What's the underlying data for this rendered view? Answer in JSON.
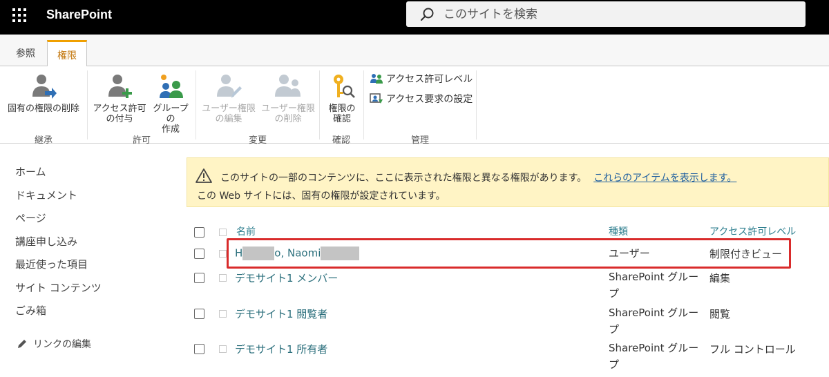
{
  "app": {
    "title": "SharePoint"
  },
  "search": {
    "placeholder": "このサイトを検索"
  },
  "ribbon": {
    "tabs": [
      {
        "label": "参照"
      },
      {
        "label": "権限"
      }
    ],
    "groups": {
      "inherit": {
        "label": "継承",
        "buttons": [
          {
            "label": "固有の権限の削除"
          }
        ]
      },
      "grant": {
        "label": "許可",
        "buttons": [
          {
            "label_l1": "アクセス許可",
            "label_l2": "の付与"
          },
          {
            "label_l1": "グループの",
            "label_l2": "作成"
          }
        ]
      },
      "modify": {
        "label": "変更",
        "buttons": [
          {
            "label_l1": "ユーザー権限",
            "label_l2": "の編集"
          },
          {
            "label_l1": "ユーザー権限",
            "label_l2": "の削除"
          }
        ]
      },
      "check": {
        "label": "確認",
        "buttons": [
          {
            "label_l1": "権限の",
            "label_l2": "確認"
          }
        ]
      },
      "manage": {
        "label": "管理",
        "buttons": [
          {
            "label": "アクセス許可レベル"
          },
          {
            "label": "アクセス要求の設定"
          }
        ]
      }
    }
  },
  "leftnav": {
    "items": [
      {
        "label": "ホーム"
      },
      {
        "label": "ドキュメント"
      },
      {
        "label": "ページ"
      },
      {
        "label": "講座申し込み"
      },
      {
        "label": "最近使った項目"
      },
      {
        "label": "サイト コンテンツ"
      },
      {
        "label": "ごみ箱"
      }
    ],
    "edit_label": "リンクの編集"
  },
  "banner": {
    "line1": "このサイトの一部のコンテンツに、ここに表示された権限と異なる権限があります。",
    "link": "これらのアイテムを表示します。",
    "line2": "この Web サイトには、固有の権限が設定されています。"
  },
  "list": {
    "columns": {
      "name": "名前",
      "type": "種類",
      "level": "アクセス許可レベル"
    },
    "rows": [
      {
        "name_start": "H",
        "name_mid": "o, Naomi",
        "type": "ユーザー",
        "level": "制限付きビュー"
      },
      {
        "name": "デモサイト1 メンバー",
        "type": "SharePoint グループ",
        "level": "編集"
      },
      {
        "name": "デモサイト1 閲覧者",
        "type": "SharePoint グループ",
        "level": "閲覧"
      },
      {
        "name": "デモサイト1 所有者",
        "type": "SharePoint グループ",
        "level": "フル コントロール"
      }
    ]
  },
  "colors": {
    "suite_bar": "#000000",
    "active_tab": "#f0a000",
    "banner_bg": "#fff4c5",
    "link": "#2b6f7c",
    "highlight": "#d92b2b"
  }
}
